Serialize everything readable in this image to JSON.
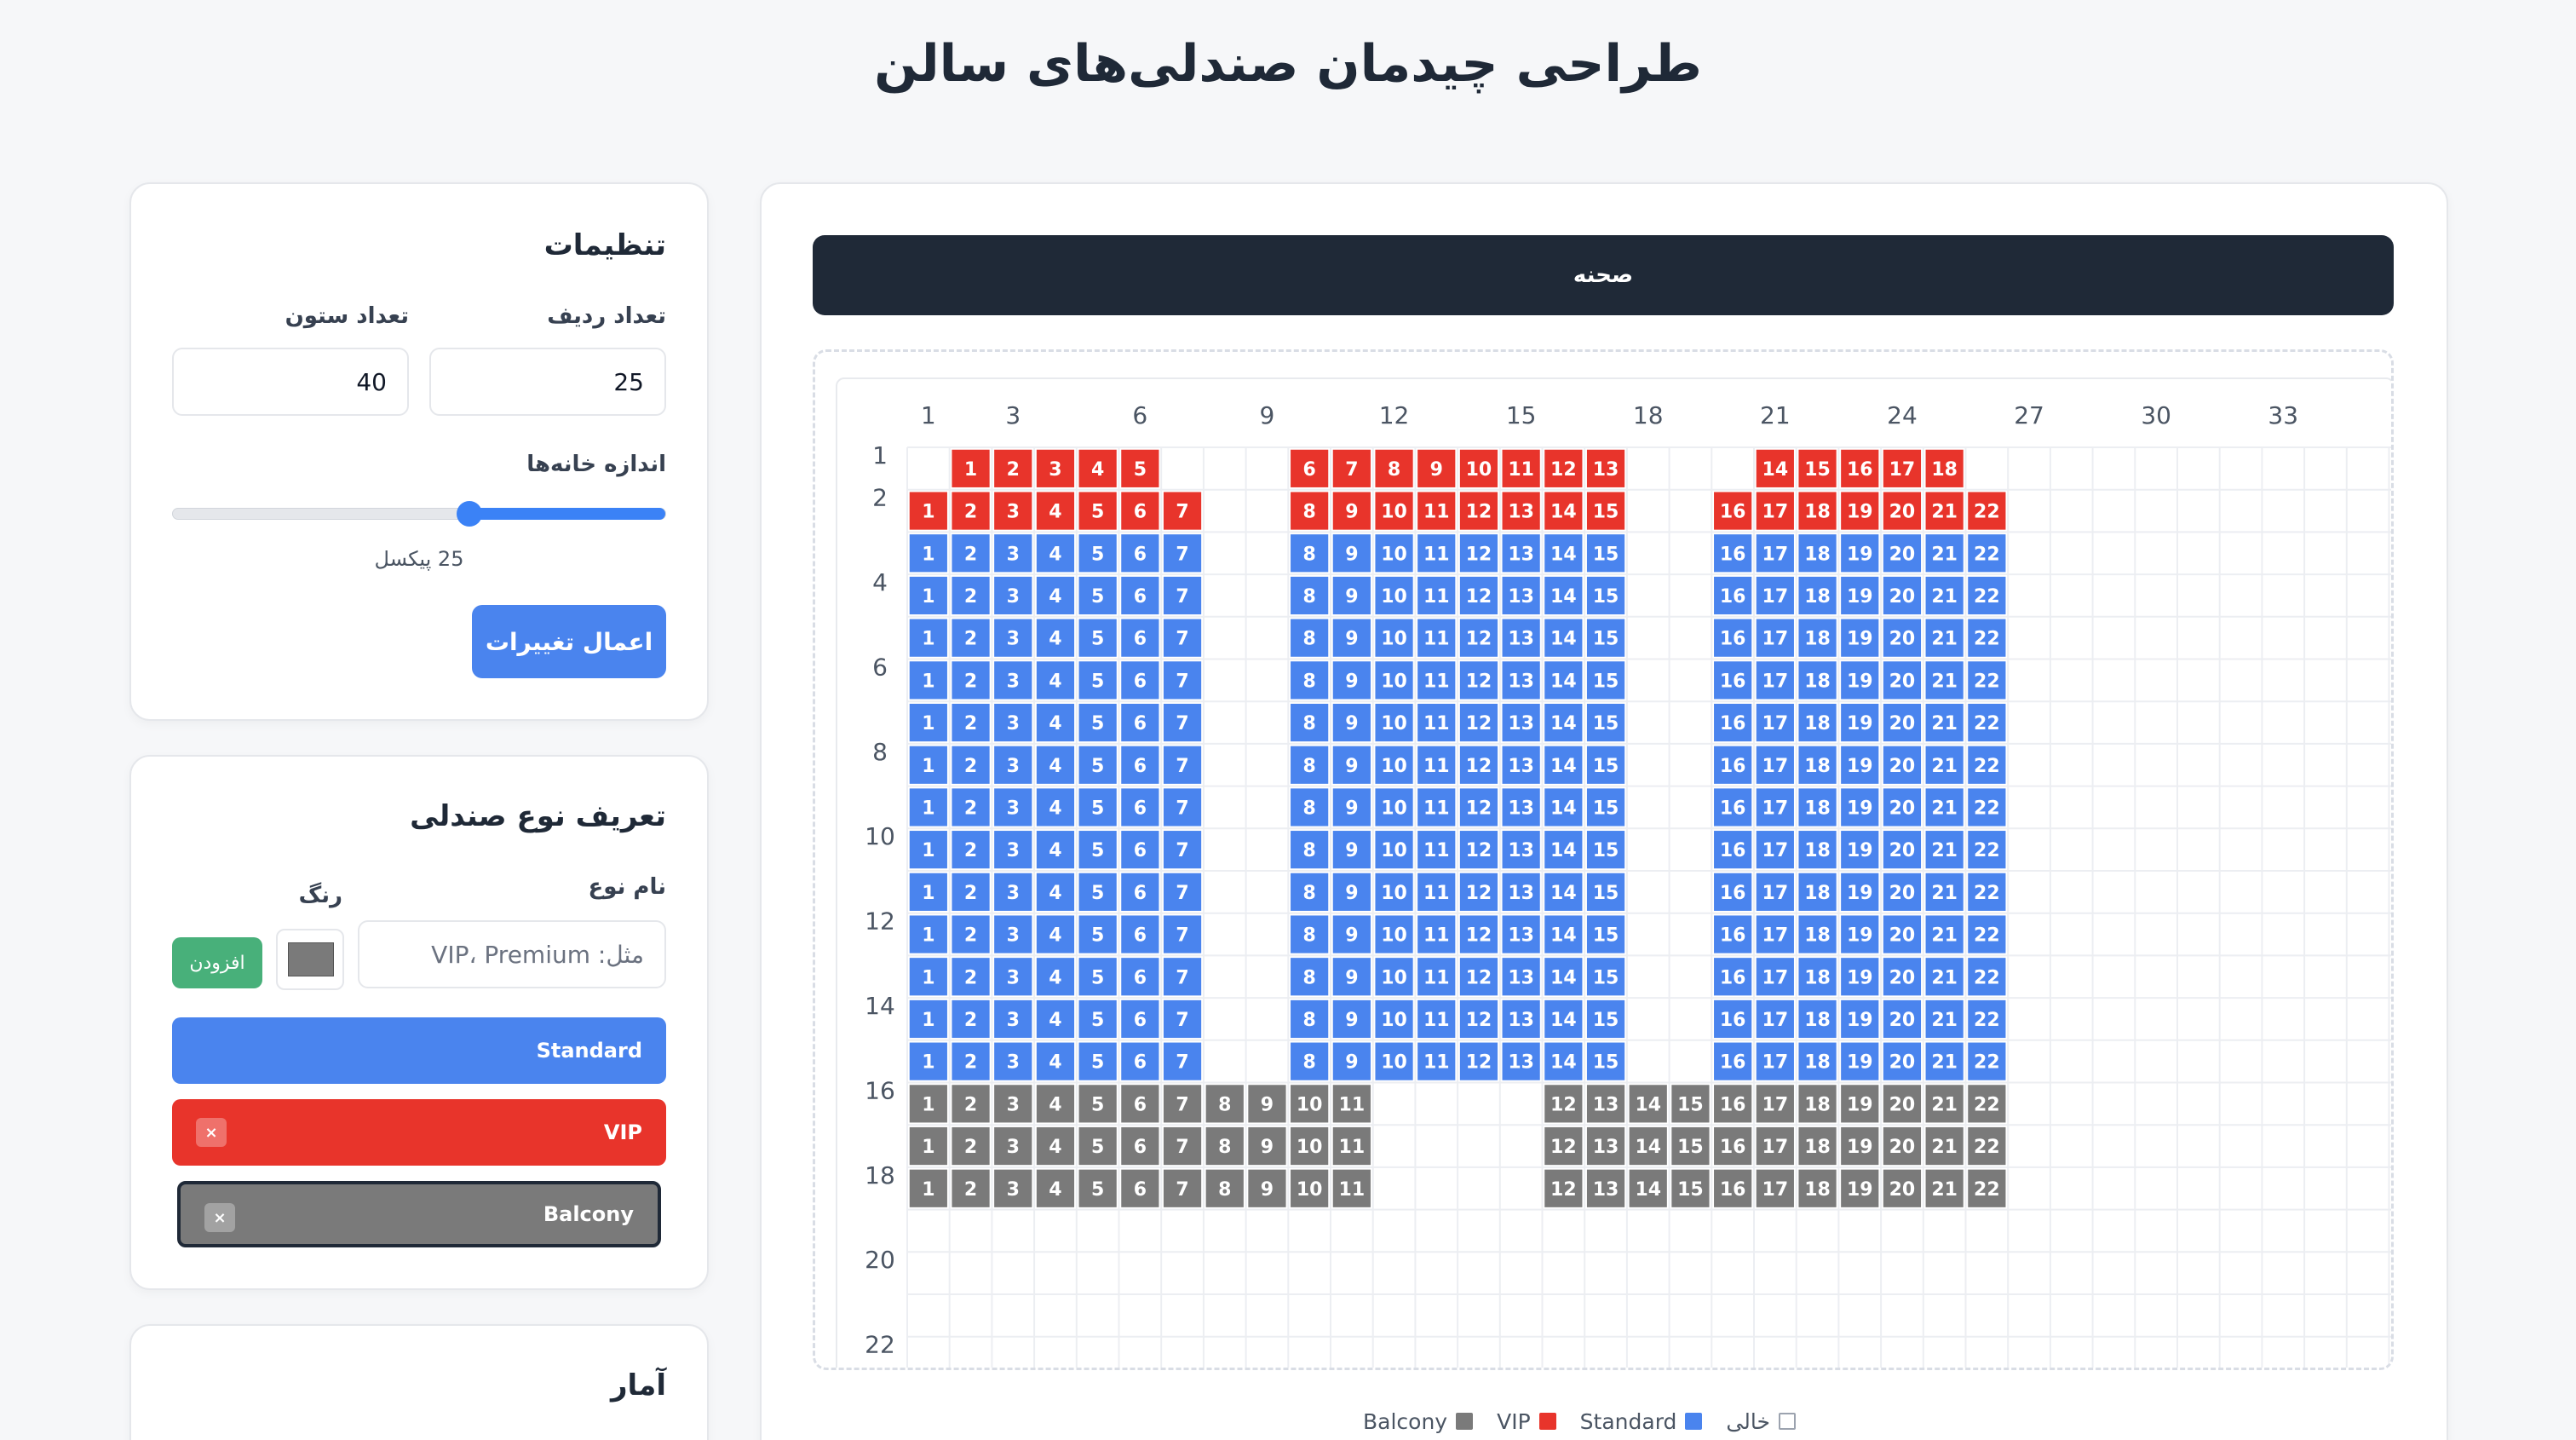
{
  "page_title": "طراحی چیدمان صندلی‌های سالن",
  "stage_label": "صحنه",
  "settings": {
    "title": "تنظیمات",
    "rows_label": "تعداد ردیف",
    "rows_value": "25",
    "cols_label": "تعداد ستون",
    "cols_value": "40",
    "cell_size_label": "اندازه خانه‌ها",
    "cell_size_value_text": "25 پیکسل",
    "cell_size_fraction": 0.6,
    "apply_label": "اعمال تغییرات"
  },
  "seat_type_form": {
    "title": "تعریف نوع صندلی",
    "name_label": "نام نوع",
    "name_placeholder": "مثل: VIP، Premium",
    "color_label": "رنگ",
    "add_label": "افزودن",
    "types": [
      {
        "name": "Standard",
        "color": "#4a84ee",
        "removable": false
      },
      {
        "name": "VIP",
        "color": "#e8342b",
        "removable": true
      },
      {
        "name": "Balcony",
        "color": "#7a7a7a",
        "removable": true
      }
    ]
  },
  "stats": {
    "title": "آمار"
  },
  "legend": [
    {
      "label": "خالی",
      "color": "#ffffff"
    },
    {
      "label": "Standard",
      "color": "#4a84ee"
    },
    {
      "label": "VIP",
      "color": "#e8342b"
    },
    {
      "label": "Balcony",
      "color": "#7a7a7a"
    }
  ],
  "grid": {
    "col_tick_labels": [
      "1",
      "3",
      "6",
      "9",
      "12",
      "15",
      "18",
      "21",
      "24",
      "27",
      "30",
      "33"
    ],
    "row_tick_labels": [
      "1",
      "2",
      "4",
      "6",
      "8",
      "10",
      "12",
      "14",
      "16",
      "18",
      "20",
      "22"
    ],
    "colors": {
      "vip": "#e8342b",
      "standard": "#4a84ee",
      "balcony": "#7a7a7a"
    },
    "rows": [
      {
        "row": 1,
        "type": "vip",
        "seats": [
          [
            2,
            1
          ],
          [
            3,
            2
          ],
          [
            4,
            3
          ],
          [
            5,
            4
          ],
          [
            6,
            5
          ],
          [
            10,
            6
          ],
          [
            11,
            7
          ],
          [
            12,
            8
          ],
          [
            13,
            9
          ],
          [
            14,
            10
          ],
          [
            15,
            11
          ],
          [
            16,
            12
          ],
          [
            17,
            13
          ],
          [
            21,
            14
          ],
          [
            22,
            15
          ],
          [
            23,
            16
          ],
          [
            24,
            17
          ],
          [
            25,
            18
          ]
        ]
      },
      {
        "row": 2,
        "type": "vip",
        "seats": [
          [
            1,
            1
          ],
          [
            2,
            2
          ],
          [
            3,
            3
          ],
          [
            4,
            4
          ],
          [
            5,
            5
          ],
          [
            6,
            6
          ],
          [
            7,
            7
          ],
          [
            10,
            8
          ],
          [
            11,
            9
          ],
          [
            12,
            10
          ],
          [
            13,
            11
          ],
          [
            14,
            12
          ],
          [
            15,
            13
          ],
          [
            16,
            14
          ],
          [
            17,
            15
          ],
          [
            20,
            16
          ],
          [
            21,
            17
          ],
          [
            22,
            18
          ],
          [
            23,
            19
          ],
          [
            24,
            20
          ],
          [
            25,
            21
          ],
          [
            26,
            22
          ]
        ]
      },
      {
        "row": 3,
        "type": "standard",
        "layout": "standard"
      },
      {
        "row": 4,
        "type": "standard",
        "layout": "standard"
      },
      {
        "row": 5,
        "type": "standard",
        "layout": "standard"
      },
      {
        "row": 6,
        "type": "standard",
        "layout": "standard"
      },
      {
        "row": 7,
        "type": "standard",
        "layout": "standard"
      },
      {
        "row": 8,
        "type": "standard",
        "layout": "standard"
      },
      {
        "row": 9,
        "type": "standard",
        "layout": "standard"
      },
      {
        "row": 10,
        "type": "standard",
        "layout": "standard"
      },
      {
        "row": 11,
        "type": "standard",
        "layout": "standard"
      },
      {
        "row": 12,
        "type": "standard",
        "layout": "standard"
      },
      {
        "row": 13,
        "type": "standard",
        "layout": "standard"
      },
      {
        "row": 14,
        "type": "standard",
        "layout": "standard"
      },
      {
        "row": 15,
        "type": "standard",
        "layout": "standard"
      },
      {
        "row": 16,
        "type": "balcony",
        "layout": "balcony"
      },
      {
        "row": 17,
        "type": "balcony",
        "layout": "balcony"
      },
      {
        "row": 18,
        "type": "balcony",
        "layout": "balcony"
      }
    ],
    "layouts": {
      "standard": [
        [
          1,
          1
        ],
        [
          2,
          2
        ],
        [
          3,
          3
        ],
        [
          4,
          4
        ],
        [
          5,
          5
        ],
        [
          6,
          6
        ],
        [
          7,
          7
        ],
        [
          10,
          8
        ],
        [
          11,
          9
        ],
        [
          12,
          10
        ],
        [
          13,
          11
        ],
        [
          14,
          12
        ],
        [
          15,
          13
        ],
        [
          16,
          14
        ],
        [
          17,
          15
        ],
        [
          20,
          16
        ],
        [
          21,
          17
        ],
        [
          22,
          18
        ],
        [
          23,
          19
        ],
        [
          24,
          20
        ],
        [
          25,
          21
        ],
        [
          26,
          22
        ]
      ],
      "balcony": [
        [
          1,
          1
        ],
        [
          2,
          2
        ],
        [
          3,
          3
        ],
        [
          4,
          4
        ],
        [
          5,
          5
        ],
        [
          6,
          6
        ],
        [
          7,
          7
        ],
        [
          8,
          8
        ],
        [
          9,
          9
        ],
        [
          10,
          10
        ],
        [
          11,
          11
        ],
        [
          16,
          12
        ],
        [
          17,
          13
        ],
        [
          18,
          14
        ],
        [
          19,
          15
        ],
        [
          20,
          16
        ],
        [
          21,
          17
        ],
        [
          22,
          18
        ],
        [
          23,
          19
        ],
        [
          24,
          20
        ],
        [
          25,
          21
        ],
        [
          26,
          22
        ]
      ]
    }
  }
}
